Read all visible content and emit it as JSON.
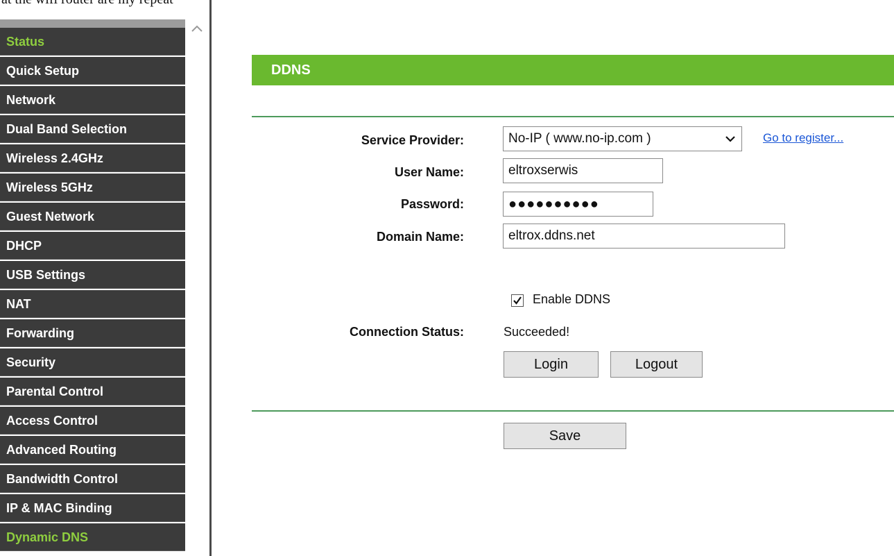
{
  "top_clipped_text": "at the wifi router are my repeat",
  "sidebar": {
    "items": [
      {
        "label": "Status",
        "active": true
      },
      {
        "label": "Quick Setup",
        "active": false
      },
      {
        "label": "Network",
        "active": false
      },
      {
        "label": "Dual Band Selection",
        "active": false
      },
      {
        "label": "Wireless 2.4GHz",
        "active": false
      },
      {
        "label": "Wireless 5GHz",
        "active": false
      },
      {
        "label": "Guest Network",
        "active": false
      },
      {
        "label": "DHCP",
        "active": false
      },
      {
        "label": "USB Settings",
        "active": false
      },
      {
        "label": "NAT",
        "active": false
      },
      {
        "label": "Forwarding",
        "active": false
      },
      {
        "label": "Security",
        "active": false
      },
      {
        "label": "Parental Control",
        "active": false
      },
      {
        "label": "Access Control",
        "active": false
      },
      {
        "label": "Advanced Routing",
        "active": false
      },
      {
        "label": "Bandwidth Control",
        "active": false
      },
      {
        "label": "IP & MAC Binding",
        "active": false
      },
      {
        "label": "Dynamic DNS",
        "active": true
      }
    ]
  },
  "page": {
    "title": "DDNS",
    "accent_color": "#6ab92f",
    "active_menu_color": "#8fce3f",
    "form": {
      "service_provider_label": "Service Provider:",
      "service_provider_value": "No-IP ( www.no-ip.com )",
      "register_link": "Go to register...",
      "user_name_label": "User Name:",
      "user_name_value": "eltroxserwis",
      "password_label": "Password:",
      "password_value": "●●●●●●●●●●",
      "domain_name_label": "Domain Name:",
      "domain_name_value": "eltrox.ddns.net",
      "enable_ddns_label": "Enable DDNS",
      "enable_ddns_checked": true,
      "connection_status_label": "Connection Status:",
      "connection_status_value": "Succeeded!",
      "login_label": "Login",
      "logout_label": "Logout",
      "save_label": "Save"
    }
  }
}
